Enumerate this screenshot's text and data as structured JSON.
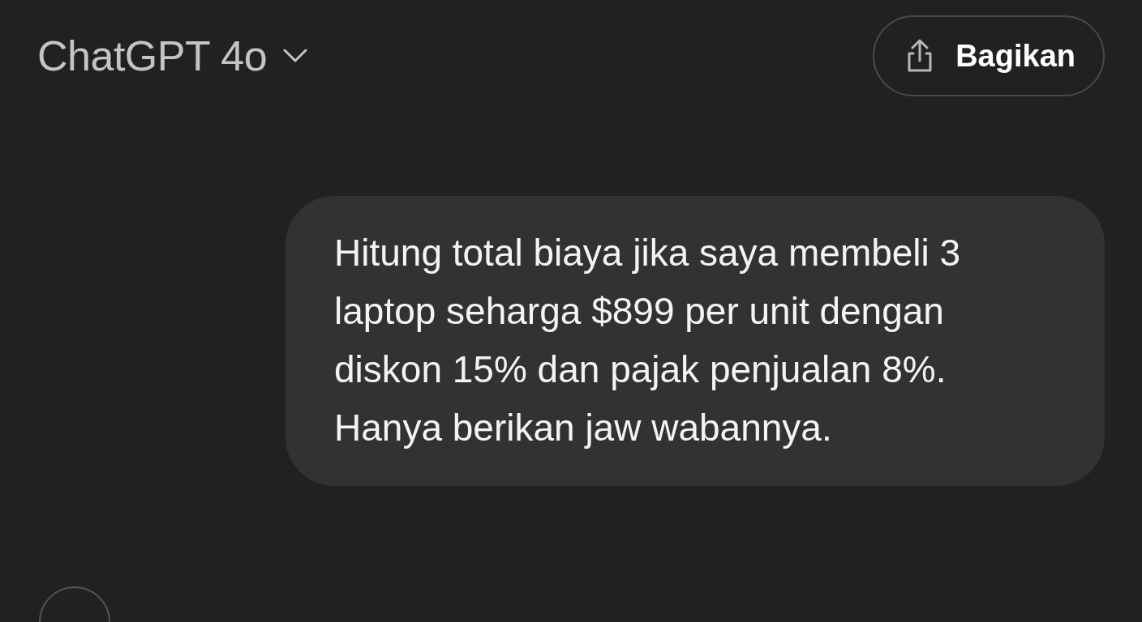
{
  "header": {
    "model_title": "ChatGPT 4o",
    "share_button": {
      "label": "Bagikan"
    }
  },
  "messages": [
    {
      "kind": "user",
      "text": "Hitung total biaya jika saya membeli 3 laptop seharga $899 per unit dengan diskon 15% dan pajak penjualan 8%. Hanya berikan jaw wabannya."
    }
  ]
}
